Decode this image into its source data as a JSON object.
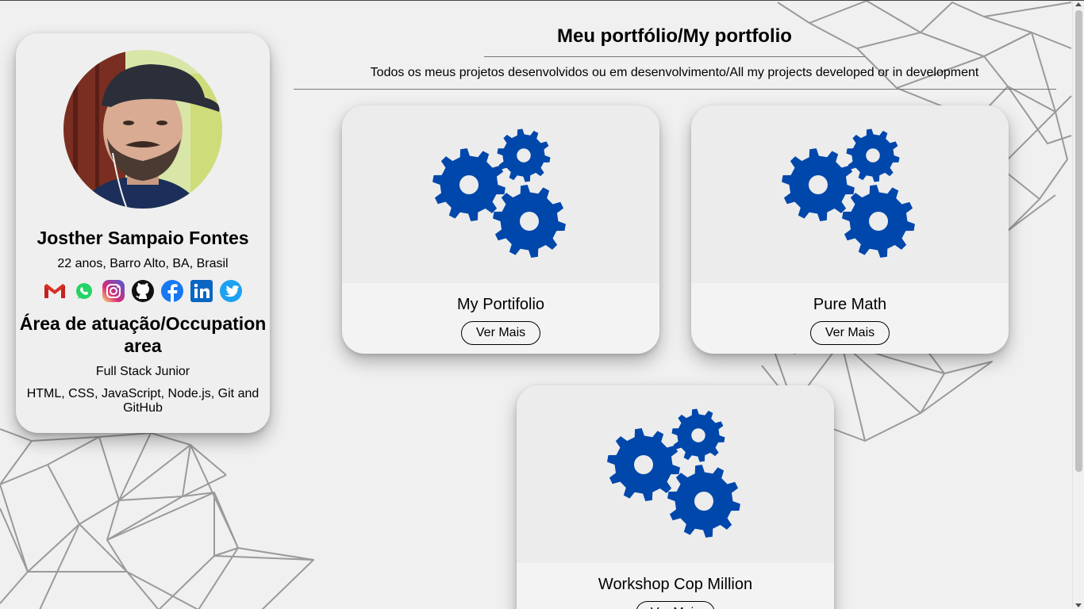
{
  "colors": {
    "background": "#f0f0f0",
    "card": "#efefef",
    "gear_blue": "#0047ab",
    "lines": "#999999"
  },
  "profile": {
    "name": "Josther Sampaio Fontes",
    "location": "22 anos, Barro Alto, BA, Brasil",
    "social_icons": [
      "gmail-icon",
      "whatsapp-icon",
      "instagram-icon",
      "github-icon",
      "facebook-icon",
      "linkedin-icon",
      "twitter-icon"
    ],
    "area_title": "Área de atuação/Occupation area",
    "role": "Full Stack Junior",
    "skills": "HTML, CSS, JavaScript, Node.js, Git and GitHub"
  },
  "header": {
    "title": "Meu portfólio/My portfolio",
    "subtitle": "Todos os meus projetos desenvolvidos ou em desenvolvimento/All my projects developed or in development"
  },
  "projects": [
    {
      "name": "My Portifolio",
      "button": "Ver Mais",
      "icon": "gears-icon"
    },
    {
      "name": "Pure Math",
      "button": "Ver Mais",
      "icon": "gears-icon"
    },
    {
      "name": "Workshop Cop Million",
      "button": "Ver Mais",
      "icon": "gears-icon"
    }
  ]
}
